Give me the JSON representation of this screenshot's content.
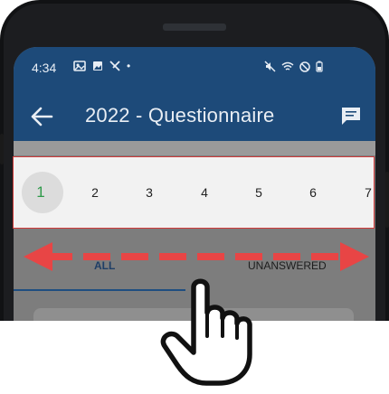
{
  "status_bar": {
    "time": "4:34",
    "dot": "•"
  },
  "app_bar": {
    "title": "2022 - Questionnaire",
    "back_icon": "arrow-left-icon",
    "chat_icon": "chat-icon"
  },
  "question_numbers": [
    "1",
    "2",
    "3",
    "4",
    "5",
    "6",
    "7"
  ],
  "active_question": "1",
  "tabs": {
    "all": "ALL",
    "unanswered": "UNANSWERED"
  },
  "colors": {
    "primary": "#1d4a79",
    "active_number": "#2f9a4a",
    "highlight_border": "#d23a3a",
    "swipe_arrow": "#e84545"
  },
  "overlay": {
    "gesture": "horizontal-swipe",
    "icons": [
      "double-arrow-icon",
      "hand-pointer-icon"
    ]
  }
}
